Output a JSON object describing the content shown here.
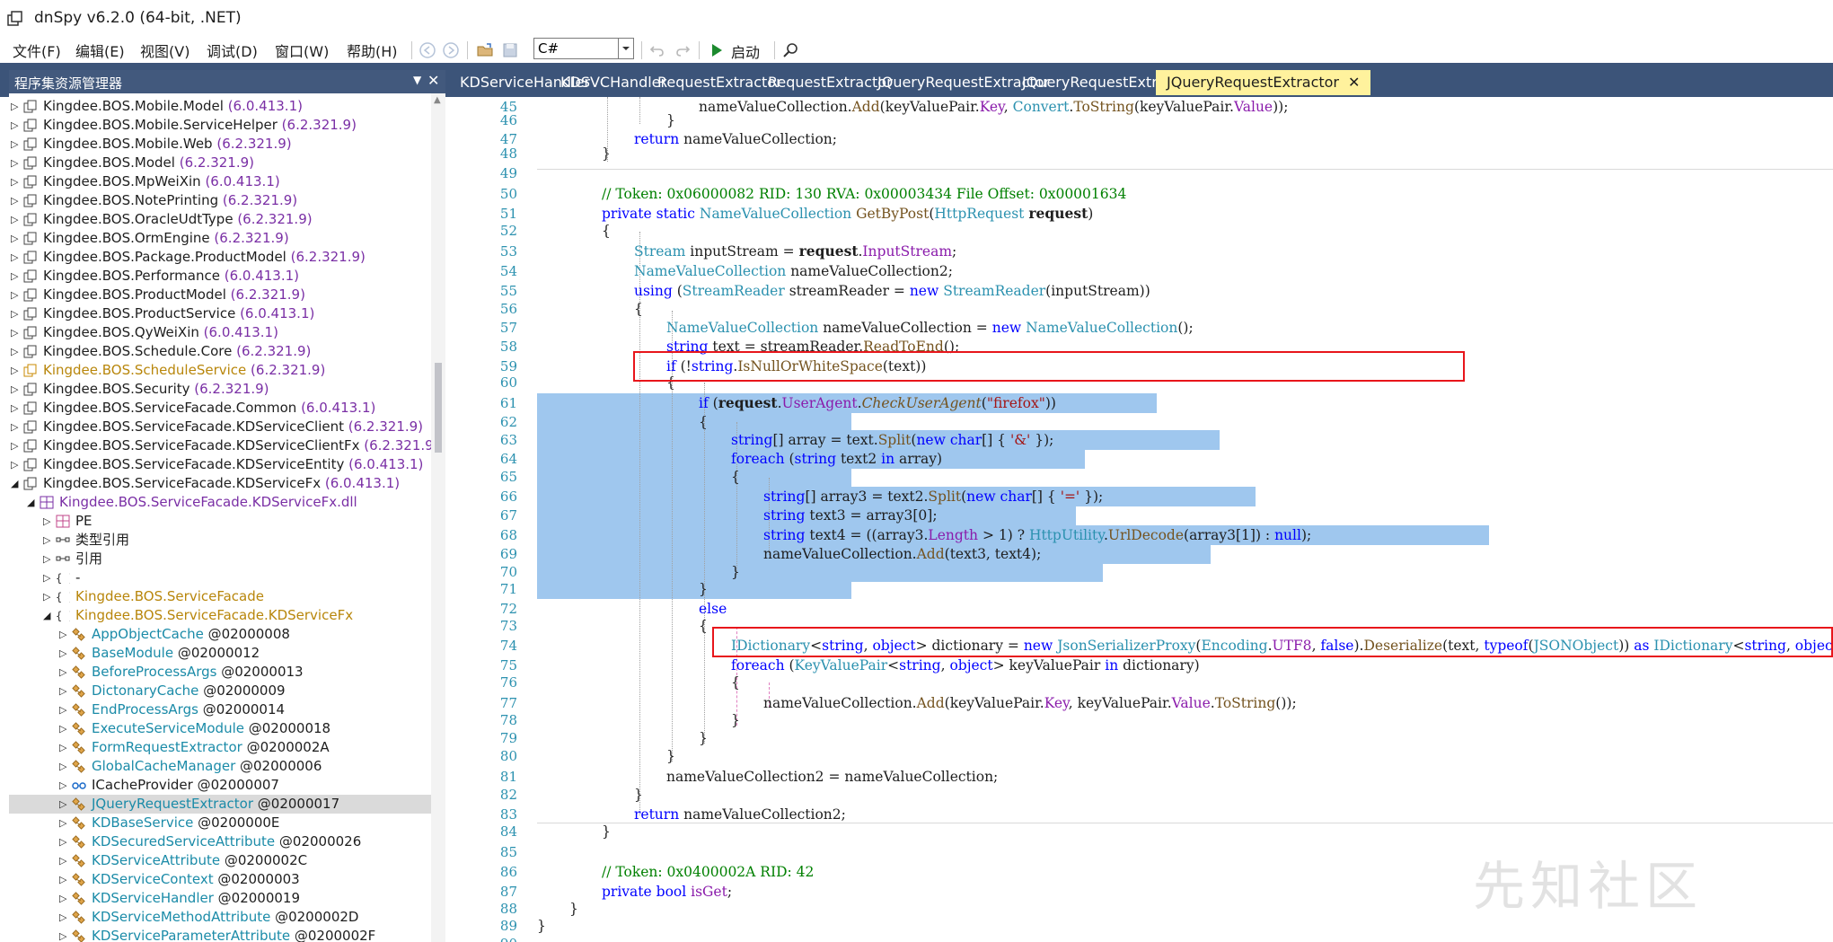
{
  "window": {
    "title": "dnSpy v6.2.0 (64-bit, .NET)"
  },
  "menu": [
    "文件(F)",
    "编辑(E)",
    "视图(V)",
    "调试(D)",
    "窗口(W)",
    "帮助(H)"
  ],
  "toolbar": {
    "language": "C#",
    "run_label": "启动"
  },
  "left_panel": {
    "title": "程序集资源管理器",
    "tree": [
      {
        "name": "Kingdee.BOS.Mobile.Model",
        "version": "(6.0.413.1)",
        "kind": "asm"
      },
      {
        "name": "Kingdee.BOS.Mobile.ServiceHelper",
        "version": "(6.2.321.9)",
        "kind": "asm"
      },
      {
        "name": "Kingdee.BOS.Mobile.Web",
        "version": "(6.2.321.9)",
        "kind": "asm"
      },
      {
        "name": "Kingdee.BOS.Model",
        "version": "(6.2.321.9)",
        "kind": "asm"
      },
      {
        "name": "Kingdee.BOS.MpWeiXin",
        "version": "(6.0.413.1)",
        "kind": "asm"
      },
      {
        "name": "Kingdee.BOS.NotePrinting",
        "version": "(6.2.321.9)",
        "kind": "asm"
      },
      {
        "name": "Kingdee.BOS.OracleUdtType",
        "version": "(6.2.321.9)",
        "kind": "asm"
      },
      {
        "name": "Kingdee.BOS.OrmEngine",
        "version": "(6.2.321.9)",
        "kind": "asm"
      },
      {
        "name": "Kingdee.BOS.Package.ProductModel",
        "version": "(6.2.321.9)",
        "kind": "asm"
      },
      {
        "name": "Kingdee.BOS.Performance",
        "version": "(6.0.413.1)",
        "kind": "asm"
      },
      {
        "name": "Kingdee.BOS.ProductModel",
        "version": "(6.2.321.9)",
        "kind": "asm"
      },
      {
        "name": "Kingdee.BOS.ProductService",
        "version": "(6.0.413.1)",
        "kind": "asm"
      },
      {
        "name": "Kingdee.BOS.QyWeiXin",
        "version": "(6.0.413.1)",
        "kind": "asm"
      },
      {
        "name": "Kingdee.BOS.Schedule.Core",
        "version": "(6.2.321.9)",
        "kind": "asm"
      },
      {
        "name": "Kingdee.BOS.ScheduleService",
        "version": "(6.2.321.9)",
        "kind": "asm-orange"
      },
      {
        "name": "Kingdee.BOS.Security",
        "version": "(6.2.321.9)",
        "kind": "asm"
      },
      {
        "name": "Kingdee.BOS.ServiceFacade.Common",
        "version": "(6.0.413.1)",
        "kind": "asm"
      },
      {
        "name": "Kingdee.BOS.ServiceFacade.KDServiceClient",
        "version": "(6.2.321.9)",
        "kind": "asm"
      },
      {
        "name": "Kingdee.BOS.ServiceFacade.KDServiceClientFx",
        "version": "(6.2.321.9)",
        "kind": "asm"
      },
      {
        "name": "Kingdee.BOS.ServiceFacade.KDServiceEntity",
        "version": "(6.0.413.1)",
        "kind": "asm"
      },
      {
        "name": "Kingdee.BOS.ServiceFacade.KDServiceFx",
        "version": "(6.0.413.1)",
        "kind": "asm-open"
      },
      {
        "name": "Kingdee.BOS.ServiceFacade.KDServiceFx.dll",
        "version": "",
        "kind": "dll"
      },
      {
        "name": "PE",
        "version": "",
        "kind": "pe"
      },
      {
        "name": "类型引用",
        "version": "",
        "kind": "ref"
      },
      {
        "name": "引用",
        "version": "",
        "kind": "ref"
      },
      {
        "name": "-",
        "version": "",
        "kind": "ns"
      },
      {
        "name": "Kingdee.BOS.ServiceFacade",
        "version": "",
        "kind": "ns-orange"
      },
      {
        "name": "Kingdee.BOS.ServiceFacade.KDServiceFx",
        "version": "",
        "kind": "ns-open"
      },
      {
        "name": "AppObjectCache",
        "version": "@02000008",
        "kind": "class"
      },
      {
        "name": "BaseModule",
        "version": "@02000012",
        "kind": "class"
      },
      {
        "name": "BeforeProcessArgs",
        "version": "@02000013",
        "kind": "class"
      },
      {
        "name": "DictonaryCache",
        "version": "@02000009",
        "kind": "class"
      },
      {
        "name": "EndProcessArgs",
        "version": "@02000014",
        "kind": "class"
      },
      {
        "name": "ExecuteServiceModule",
        "version": "@02000018",
        "kind": "class"
      },
      {
        "name": "FormRequestExtractor",
        "version": "@0200002A",
        "kind": "class"
      },
      {
        "name": "GlobalCacheManager",
        "version": "@02000006",
        "kind": "class"
      },
      {
        "name": "ICacheProvider",
        "version": "@02000007",
        "kind": "iface"
      },
      {
        "name": "JQueryRequestExtractor",
        "version": "@02000017",
        "kind": "class-sel"
      },
      {
        "name": "KDBaseService",
        "version": "@0200000E",
        "kind": "class"
      },
      {
        "name": "KDSecuredServiceAttribute",
        "version": "@02000026",
        "kind": "class"
      },
      {
        "name": "KDServiceAttribute",
        "version": "@0200002C",
        "kind": "class"
      },
      {
        "name": "KDServiceContext",
        "version": "@02000003",
        "kind": "class"
      },
      {
        "name": "KDServiceHandler",
        "version": "@02000019",
        "kind": "class"
      },
      {
        "name": "KDServiceMethodAttribute",
        "version": "@0200002D",
        "kind": "class"
      },
      {
        "name": "KDServiceParameterAttribute",
        "version": "@0200002F",
        "kind": "class"
      }
    ]
  },
  "tabs": [
    {
      "label": "KDServiceHandler"
    },
    {
      "label": "KDSVCHandler"
    },
    {
      "label": "RequestExtractor"
    },
    {
      "label": "RequestExtractor"
    },
    {
      "label": "JQueryRequestExtractor"
    },
    {
      "label": "JQueryRequestExtractor"
    },
    {
      "label": "JQueryRequestExtractor",
      "active": true
    }
  ],
  "code_lines": [
    {
      "n": "45",
      "t": "nameValueCollection.Add(keyValuePair.Key, Convert.ToString(keyValuePair.Value));"
    },
    {
      "n": "46",
      "t": "}"
    },
    {
      "n": "47",
      "t": "return nameValueCollection;"
    },
    {
      "n": "48",
      "t": "}"
    },
    {
      "n": "49",
      "t": ""
    },
    {
      "n": "50",
      "t": "// Token: 0x06000082 RID: 130 RVA: 0x00003434 File Offset: 0x00001634"
    },
    {
      "n": "51",
      "t": "private static NameValueCollection GetByPost(HttpRequest request)"
    },
    {
      "n": "52",
      "t": "{"
    },
    {
      "n": "53",
      "t": "Stream inputStream = request.InputStream;"
    },
    {
      "n": "54",
      "t": "NameValueCollection nameValueCollection2;"
    },
    {
      "n": "55",
      "t": "using (StreamReader streamReader = new StreamReader(inputStream))"
    },
    {
      "n": "56",
      "t": "{"
    },
    {
      "n": "57",
      "t": "NameValueCollection nameValueCollection = new NameValueCollection();"
    },
    {
      "n": "58",
      "t": "string text = streamReader.ReadToEnd();"
    },
    {
      "n": "59",
      "t": "if (!string.IsNullOrWhiteSpace(text))"
    },
    {
      "n": "60",
      "t": "{"
    },
    {
      "n": "61",
      "t": "if (request.UserAgent.CheckUserAgent(\"firefox\"))"
    },
    {
      "n": "62",
      "t": "{"
    },
    {
      "n": "63",
      "t": "string[] array = text.Split(new char[] { '&' });"
    },
    {
      "n": "64",
      "t": "foreach (string text2 in array)"
    },
    {
      "n": "65",
      "t": "{"
    },
    {
      "n": "66",
      "t": "string[] array3 = text2.Split(new char[] { '=' });"
    },
    {
      "n": "67",
      "t": "string text3 = array3[0];"
    },
    {
      "n": "68",
      "t": "string text4 = ((array3.Length > 1) ? HttpUtility.UrlDecode(array3[1]) : null);"
    },
    {
      "n": "69",
      "t": "nameValueCollection.Add(text3, text4);"
    },
    {
      "n": "70",
      "t": "}"
    },
    {
      "n": "71",
      "t": "}"
    },
    {
      "n": "72",
      "t": "else"
    },
    {
      "n": "73",
      "t": "{"
    },
    {
      "n": "74",
      "t": "IDictionary<string, object> dictionary = new JsonSerializerProxy(Encoding.UTF8, false).Deserialize(text, typeof(JSONObject)) as IDictionary<string, object>;"
    },
    {
      "n": "75",
      "t": "foreach (KeyValuePair<string, object> keyValuePair in dictionary)"
    },
    {
      "n": "76",
      "t": "{"
    },
    {
      "n": "77",
      "t": "nameValueCollection.Add(keyValuePair.Key, keyValuePair.Value.ToString());"
    },
    {
      "n": "78",
      "t": "}"
    },
    {
      "n": "79",
      "t": "}"
    },
    {
      "n": "80",
      "t": "}"
    },
    {
      "n": "81",
      "t": "nameValueCollection2 = nameValueCollection;"
    },
    {
      "n": "82",
      "t": "}"
    },
    {
      "n": "83",
      "t": "return nameValueCollection2;"
    },
    {
      "n": "84",
      "t": "}"
    },
    {
      "n": "85",
      "t": ""
    },
    {
      "n": "86",
      "t": "// Token: 0x0400002A RID: 42"
    },
    {
      "n": "87",
      "t": "private bool isGet;"
    },
    {
      "n": "88",
      "t": "}"
    },
    {
      "n": "89",
      "t": "}"
    },
    {
      "n": "90",
      "t": ""
    }
  ],
  "watermark": "先知社区"
}
